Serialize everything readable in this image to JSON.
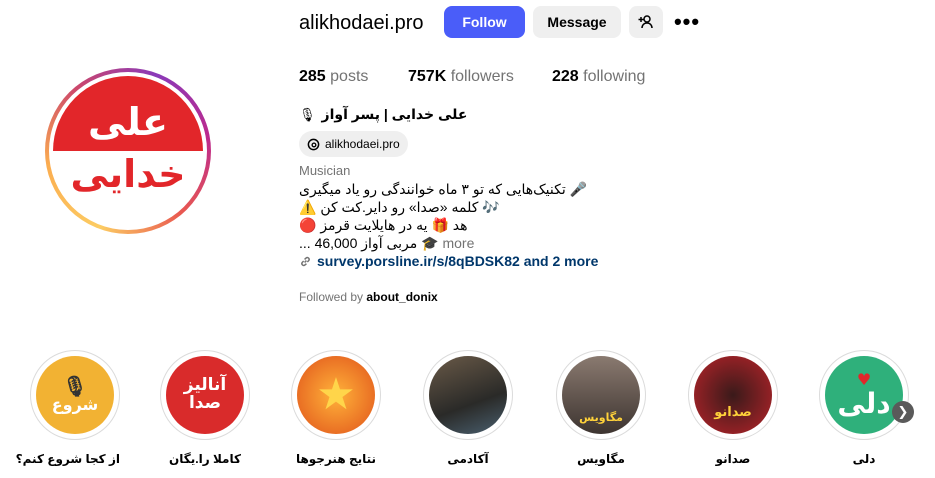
{
  "profile": {
    "username": "alikhodaei.pro",
    "avatar_text_top": "علی",
    "avatar_text_bottom": "خدایی",
    "follow_label": "Follow",
    "message_label": "Message",
    "stats": {
      "posts_count": "285",
      "posts_label": "posts",
      "followers_count": "757K",
      "followers_label": "followers",
      "following_count": "228",
      "following_label": "following"
    },
    "full_name": "علی خدایی | پسر آواز",
    "threads_handle": "alikhodaei.pro",
    "category": "Musician",
    "bio_lines": [
      "🎤 تکنیک‌هایی که تو ۳ ماه خوانندگی رو یاد میگیری",
      "🎶 کلمه «صدا» رو دایر.کت کن ⚠️",
      "هد 🎁 یه در هایلایت قرمز 🔴",
      "🎓 مربی آواز 46,000 ..."
    ],
    "bio_more": "more",
    "link_text": "survey.porsline.ir/s/8qBDSK82 and 2 more",
    "followed_by_prefix": "Followed by",
    "followed_by_user": "about_donix"
  },
  "highlights": [
    {
      "label": "از کجا شروع کنم؟",
      "art": "شروع",
      "color": "#f2b233"
    },
    {
      "label": "کاملا را.یگان",
      "art": "آنالیز صدا",
      "color": "#d92b2b"
    },
    {
      "label": "نتایج هنرجوها",
      "art": "★",
      "color": "#f07d1a"
    },
    {
      "label": "آکادمی",
      "art": "",
      "color": "#3b3a35"
    },
    {
      "label": "مگاویس",
      "art": "مگاویس",
      "color": "#5b4b43"
    },
    {
      "label": "صدانو",
      "art": "صدانو",
      "color": "#b9242a"
    },
    {
      "label": "دلی",
      "art": "دلی",
      "color": "#2fb07b"
    }
  ]
}
